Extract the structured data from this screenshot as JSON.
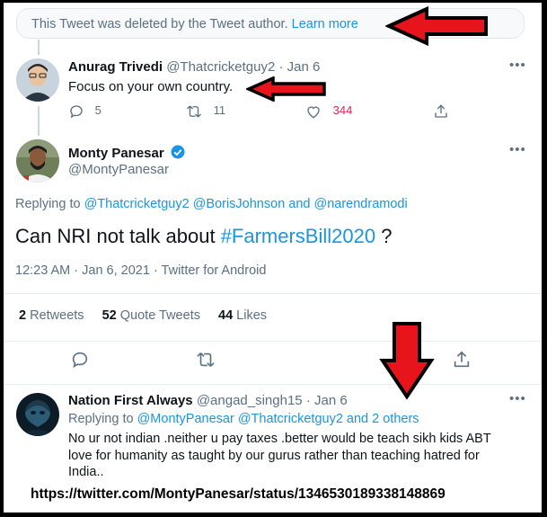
{
  "deleted_notice": {
    "text": "This Tweet was deleted by the Tweet author.",
    "link": "Learn more"
  },
  "tweet1": {
    "name": "Anurag Trivedi",
    "handle": "@Thatcricketguy2",
    "date": "· Jan 6",
    "text": "Focus on your own country.",
    "replies": "5",
    "retweets": "11",
    "likes": "344"
  },
  "main_tweet": {
    "name": "Monty Panesar",
    "handle": "@MontyPanesar",
    "replying_prefix": "Replying to",
    "replying_to": "@Thatcricketguy2 @BorisJohnson and @narendramodi",
    "text_before": "Can NRI not talk about ",
    "hashtag": "#FarmersBill2020",
    "text_after": " ?",
    "meta": "12:23 AM · Jan 6, 2021 · Twitter for Android",
    "retweets_count": "2",
    "retweets_label": "Retweets",
    "quotes_count": "52",
    "quotes_label": "Quote Tweets",
    "likes_count": "44",
    "likes_label": "Likes"
  },
  "reply_tweet": {
    "name": "Nation First Always",
    "handle": "@angad_singh15",
    "date": "· Jan 6",
    "replying_prefix": "Replying to",
    "replying_to": "@MontyPanesar @Thatcricketguy2 and 2 others",
    "text": "No ur not indian .neither u pay taxes .better would be teach sikh kids ABT love for humanity as taught by our gurus rather than teaching hatred for India.."
  },
  "caption_url": "https://twitter.com/MontyPanesar/status/1346530189338148869",
  "more_glyph": "•••",
  "colors": {
    "accent": "#1b95e0",
    "like_pink": "#e0245e",
    "arrow_red": "#e8141b",
    "muted": "#5b7083"
  }
}
